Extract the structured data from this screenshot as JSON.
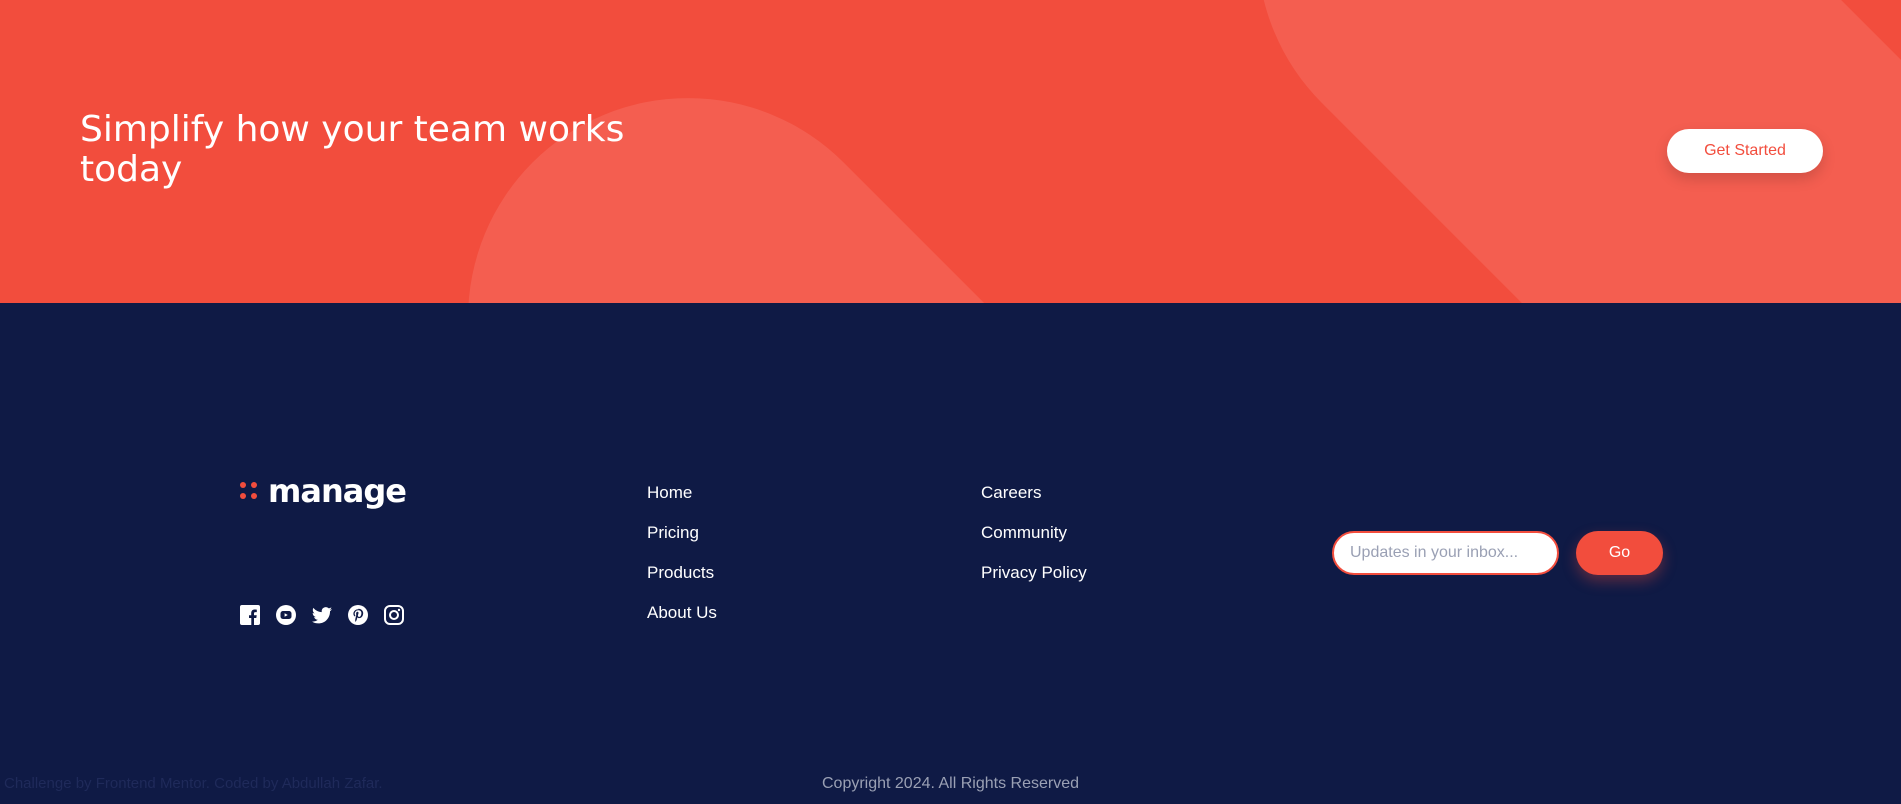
{
  "cta": {
    "heading": "Simplify how your team works today",
    "button_label": "Get Started"
  },
  "footer": {
    "logo": {
      "wordmark": "manage",
      "icon": "manage-logo-dots-icon"
    },
    "social_icons": [
      "facebook-icon",
      "youtube-icon",
      "twitter-icon",
      "pinterest-icon",
      "instagram-icon"
    ],
    "nav_column_1": [
      "Home",
      "Pricing",
      "Products",
      "About Us"
    ],
    "nav_column_2": [
      "Careers",
      "Community",
      "Privacy Policy"
    ],
    "newsletter": {
      "placeholder": "Updates in your inbox...",
      "button_label": "Go"
    },
    "attribution": {
      "prefix": "Challenge by",
      "challenge_link": "Frontend Mentor",
      "middle": ". Coded by",
      "author_link": "Abdullah Zafar",
      "suffix": "."
    },
    "copyright": "Copyright 2024. All Rights Reserved"
  },
  "colors": {
    "accent": "#f24d3d",
    "accent_light": "#f45e50",
    "footer_bg": "#0f1a45",
    "white": "#ffffff",
    "muted": "#9aa0b4"
  }
}
